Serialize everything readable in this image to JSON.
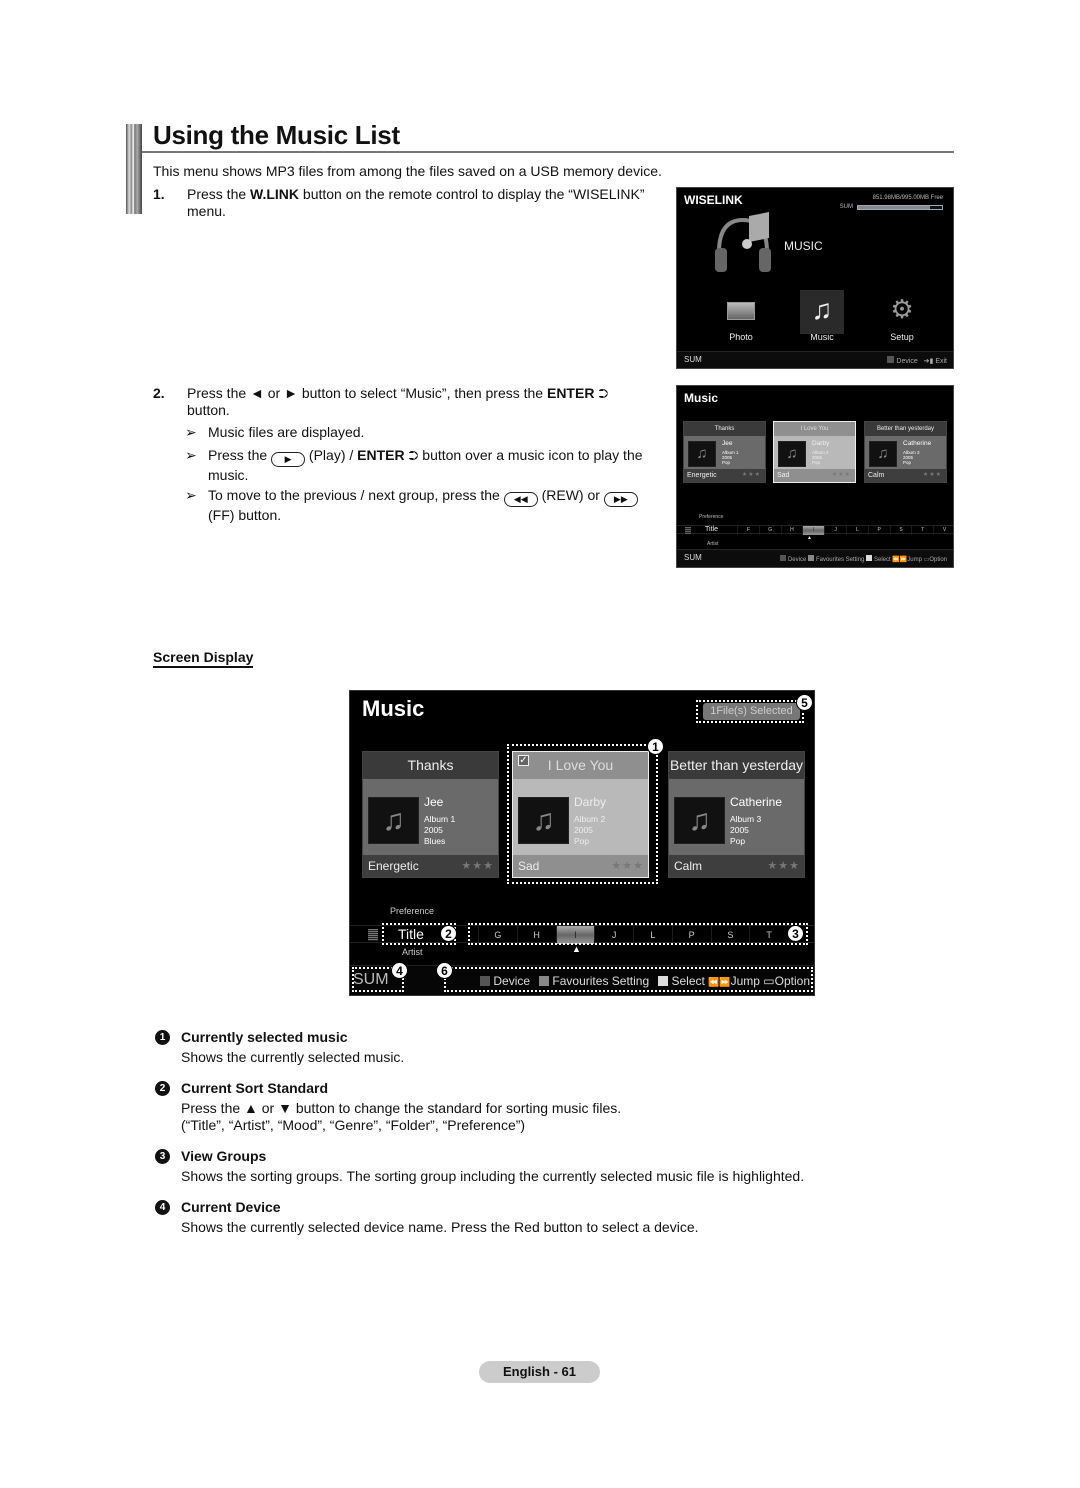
{
  "section": {
    "title": "Using the Music List",
    "intro": "This menu shows MP3 files from among the files saved on a USB memory device."
  },
  "steps": [
    {
      "num": "1.",
      "text_pre": "Press the ",
      "text_bold": "W.LINK",
      "text_post": " button on the remote control to display the “WISELINK” menu."
    },
    {
      "num": "2.",
      "text_pre": "Press the ◄ or ► button to select “Music”, then press the ",
      "text_bold": "ENTER",
      "text_post": " button.",
      "enter_icon": "⮊",
      "notes": [
        {
          "pre": "Music files are displayed.",
          "bold": "",
          "post": ""
        },
        {
          "pre": "Press the ",
          "icon": "▶",
          "mid": " (Play) / ",
          "bold": "ENTER",
          "post": " button over a music icon to play the music."
        },
        {
          "pre": "To move to the previous / next group, press the ",
          "icon": "◀◀",
          "mid": " (REW) or ",
          "icon2": "▶▶",
          "post": " (FF) button."
        }
      ],
      "note_arrow": "➢"
    }
  ],
  "wiselink": {
    "title": "WISELINK",
    "free_space": "851.98MB/995.00MB Free",
    "device_label": "SUM",
    "storage_used_fraction": 0.86,
    "category": "MUSIC",
    "apps": [
      {
        "label": "Photo",
        "icon": "photo-icon"
      },
      {
        "label": "Music",
        "icon": "music-note-icon",
        "selected": true
      },
      {
        "label": "Setup",
        "icon": "gear-icon"
      }
    ],
    "footer": {
      "device": "SUM",
      "device_key": "Device",
      "exit_key": "Exit"
    }
  },
  "music_small": {
    "title": "Music",
    "cards": [
      {
        "title": "Thanks",
        "artist": "Jee",
        "album": "Album 1",
        "year": "2005",
        "genre": "Pop",
        "mood": "Energetic",
        "stars": "★★★"
      },
      {
        "title": "I Love You",
        "artist": "Darby",
        "album": "Album 2",
        "year": "2005",
        "genre": "Pop",
        "mood": "Sad",
        "stars": "★★★",
        "selected": true
      },
      {
        "title": "Better than yesterday",
        "artist": "Catherine",
        "album": "Album 3",
        "year": "2005",
        "genre": "Pop",
        "mood": "Calm",
        "stars": "★★★"
      }
    ],
    "sort": {
      "above": "Preference",
      "current": "Title",
      "below": "Artist"
    },
    "groups": [
      "F",
      "G",
      "H",
      "I",
      "J",
      "L",
      "P",
      "S",
      "T",
      "V"
    ],
    "highlighted_group": "I",
    "footer": {
      "device": "SUM",
      "keys": [
        "Device",
        "Favourites Setting",
        "Select",
        "Jump",
        "Option"
      ]
    }
  },
  "screen_display": {
    "label": "Screen Display",
    "title": "Music",
    "selected_badge": "1File(s) Selected",
    "cards": [
      {
        "title": "Thanks",
        "artist": "Jee",
        "album": "Album 1",
        "year": "2005",
        "genre": "Blues",
        "mood": "Energetic",
        "stars": "★★★"
      },
      {
        "title": "I Love You",
        "artist": "Darby",
        "album": "Album 2",
        "year": "2005",
        "genre": "Pop",
        "mood": "Sad",
        "stars": "★★★",
        "selected": true,
        "checked": true
      },
      {
        "title": "Better than yesterday",
        "artist": "Catherine",
        "album": "Album 3",
        "year": "2005",
        "genre": "Pop",
        "mood": "Calm",
        "stars": "★★★"
      }
    ],
    "sort": {
      "above": "Preference",
      "current": "Title",
      "below": "Artist"
    },
    "groups": [
      "G",
      "H",
      "I",
      "J",
      "L",
      "P",
      "S",
      "T"
    ],
    "highlighted_group": "I",
    "footer": {
      "device": "SUM",
      "keys": [
        "Device",
        "Favourites Setting",
        "Select",
        "Jump",
        "Option"
      ]
    },
    "callouts": [
      "1",
      "2",
      "3",
      "4",
      "5",
      "6"
    ]
  },
  "descriptions": [
    {
      "num": "1",
      "heading": "Currently selected music",
      "body": "Shows the currently selected music."
    },
    {
      "num": "2",
      "heading": "Current Sort Standard",
      "body": "Press the ▲ or ▼ button to change the standard for sorting music files.",
      "body2": "(“Title”, “Artist”, “Mood”, “Genre”, “Folder”, “Preference”)"
    },
    {
      "num": "3",
      "heading": "View Groups",
      "body": "Shows the sorting groups. The sorting group including the currently selected music file is highlighted."
    },
    {
      "num": "4",
      "heading": "Current Device",
      "body": "Shows the currently selected device name. Press the Red button to select a device."
    }
  ],
  "footer": {
    "page_label": "English - 61"
  }
}
